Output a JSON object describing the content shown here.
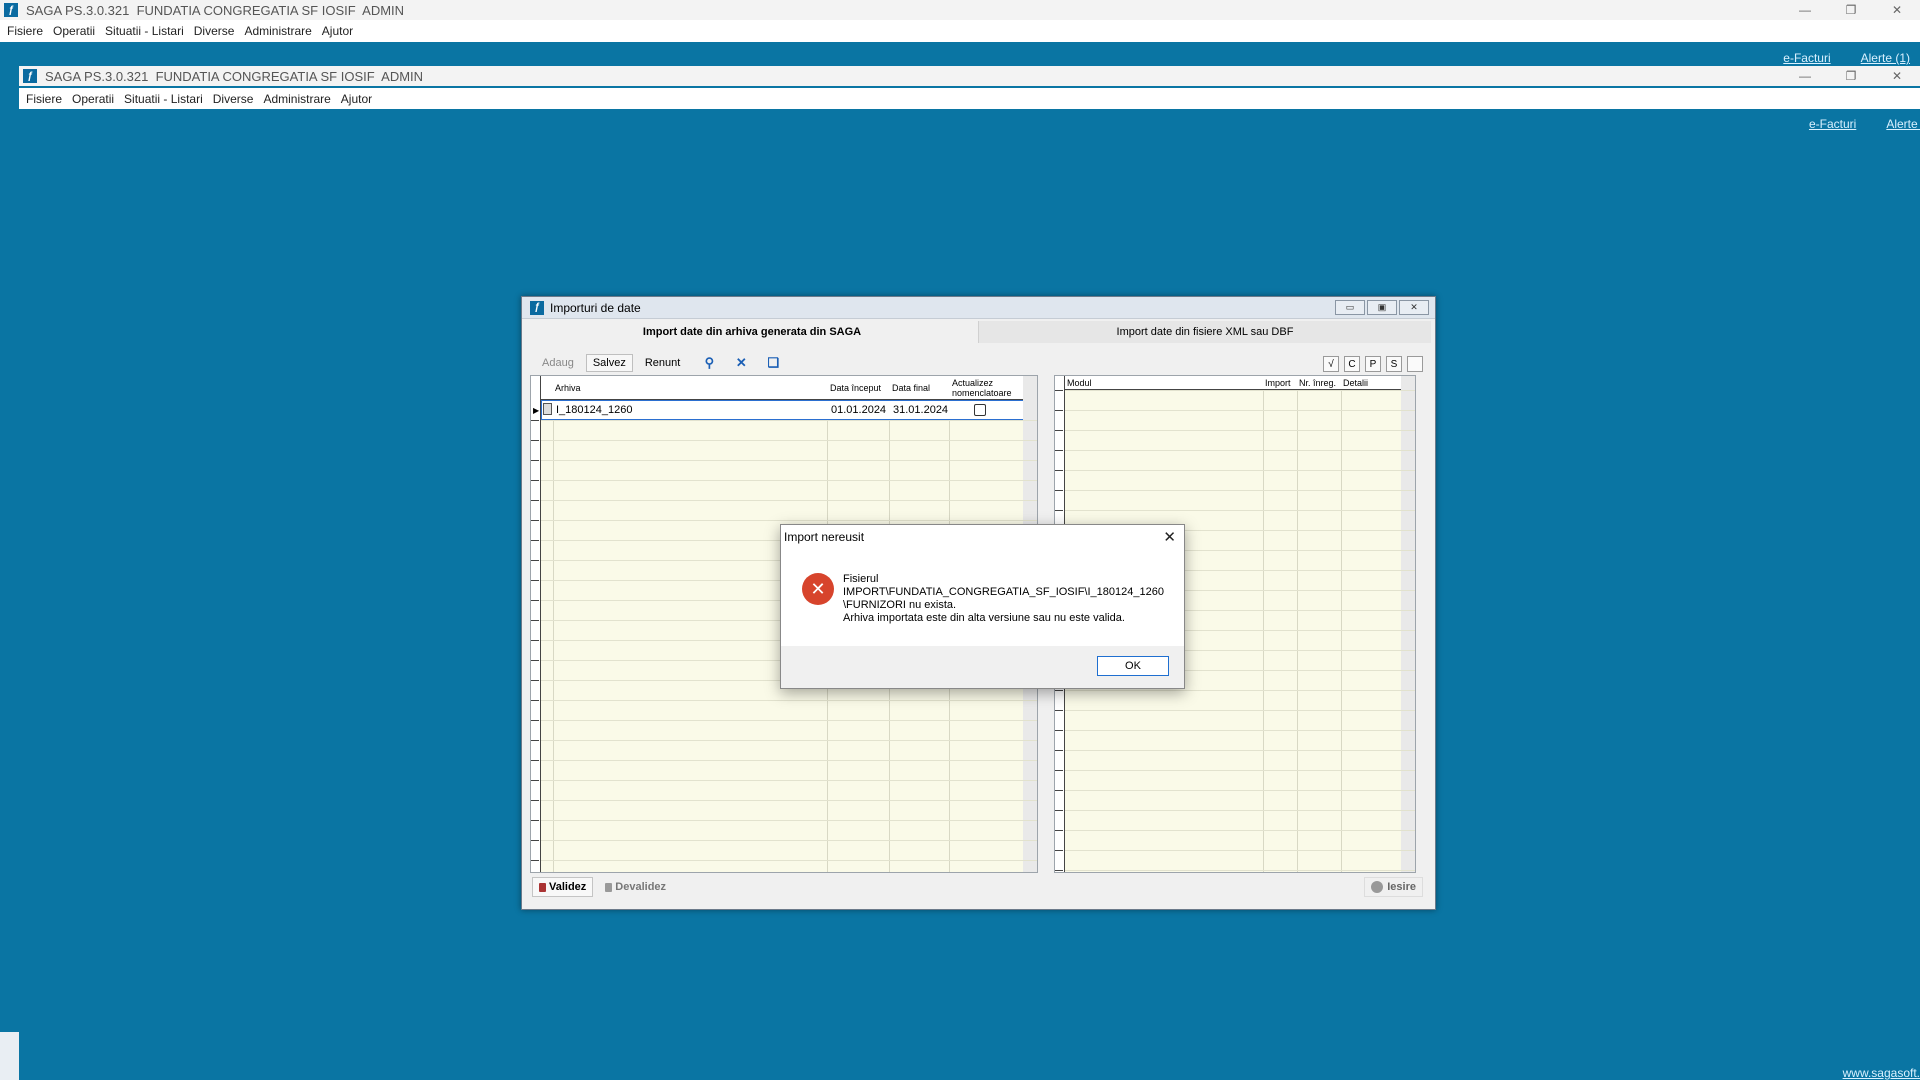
{
  "outer_window": {
    "title": "SAGA PS.3.0.321  FUNDATIA CONGREGATIA SF IOSIF  ADMIN",
    "menu": [
      "Fisiere",
      "Operatii",
      "Situatii - Listari",
      "Diverse",
      "Administrare",
      "Ajutor"
    ],
    "links": {
      "efacturi": "e-Facturi",
      "alerte": "Alerte (1)"
    }
  },
  "inner_window": {
    "title": "SAGA PS.3.0.321  FUNDATIA CONGREGATIA SF IOSIF  ADMIN",
    "menu": [
      "Fisiere",
      "Operatii",
      "Situatii - Listari",
      "Diverse",
      "Administrare",
      "Ajutor"
    ],
    "links": {
      "efacturi": "e-Facturi",
      "alerte": "Alerte ("
    }
  },
  "dialog": {
    "title": "Importuri de date",
    "tabs": [
      "Import date din arhiva generata din SAGA",
      "Import date din fisiere XML sau DBF"
    ],
    "toolbar": {
      "adaug": "Adaug",
      "salvez": "Salvez",
      "renunt": "Renunt"
    },
    "right_toolbar": [
      "√",
      "C",
      "P",
      "S",
      ""
    ],
    "left_grid": {
      "columns": [
        "Arhiva",
        "Data început",
        "Data final",
        "Actualizez nomenclatoare"
      ],
      "rows": [
        {
          "arhiva": "I_180124_1260",
          "data_inceput": "01.01.2024",
          "data_final": "31.01.2024",
          "actualizez": false
        }
      ]
    },
    "right_grid": {
      "columns": [
        "Modul",
        "Import",
        "Nr. înreg.",
        "Detalii"
      ]
    },
    "bottom": {
      "validez": "Validez",
      "devalidez": "Devalidez",
      "iesire": "Iesire"
    }
  },
  "message_box": {
    "title": "Import nereusit",
    "text": "Fisierul\nIMPORT\\FUNDATIA_CONGREGATIA_SF_IOSIF\\I_180124_1260\\FURNIZORI nu exista.\nArhiva importata este din alta versiune sau nu este valida.",
    "ok": "OK"
  },
  "footer": {
    "link": "www.sagasoft."
  },
  "colors": {
    "desktop": "#0a75a3",
    "grid_bg": "#fafae8",
    "error": "#d7442c"
  }
}
